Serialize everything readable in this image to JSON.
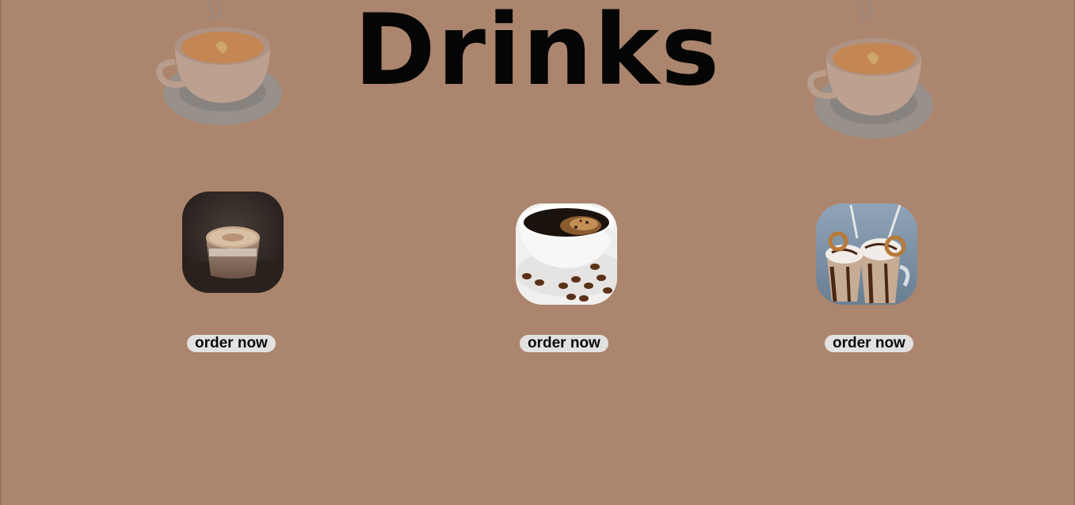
{
  "header": {
    "title": "Drinks"
  },
  "decorations": [
    {
      "icon": "coffee-cup-steam-icon"
    },
    {
      "icon": "coffee-cup-steam-icon"
    }
  ],
  "products": [
    {
      "image": "latte-cup-image",
      "button_label": "order now"
    },
    {
      "image": "black-coffee-beans-image",
      "button_label": "order now"
    },
    {
      "image": "chocolate-milkshake-image",
      "button_label": "order now"
    }
  ],
  "colors": {
    "background": "#ab856d",
    "button_bg": "#e3e1e0",
    "title": "#050505"
  }
}
